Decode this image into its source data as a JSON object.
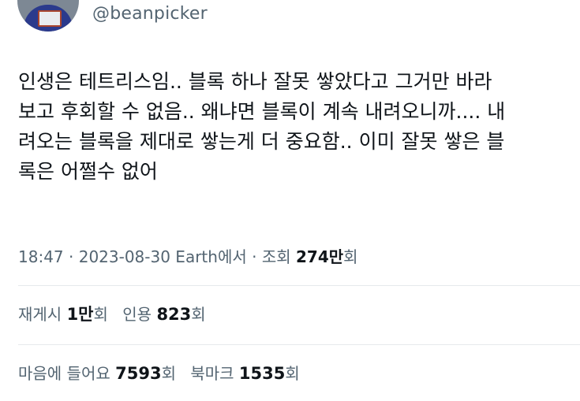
{
  "author": {
    "handle": "@beanpicker"
  },
  "tweet": {
    "text": "인생은 테트리스임.. 블록 하나 잘못 쌓았다고 그거만 바라\n보고 후회할 수 없음.. 왜냐면 블록이 계속 내려오니까.... 내\n려오는 블록을 제대로 쌓는게 더 중요함.. 이미 잘못 쌓은 블\n록은 어쩔수 없어"
  },
  "meta": {
    "time": "18:47",
    "sep1": " · ",
    "date": "2023-08-30",
    "source": " Earth에서",
    "sep2": " · ",
    "views_label": "조회 ",
    "views_value": "274만",
    "views_unit": "회"
  },
  "stats": {
    "retweets": {
      "label": "재게시 ",
      "value": "1만",
      "unit": "회"
    },
    "quotes": {
      "label": "인용 ",
      "value": "823",
      "unit": "회"
    },
    "likes": {
      "label": "마음에 들어요 ",
      "value": "7593",
      "unit": "회"
    },
    "bookmarks": {
      "label": "북마크 ",
      "value": "1535",
      "unit": "회"
    }
  },
  "colors": {
    "text": "#0f1419",
    "secondary": "#536471",
    "divider": "#e6e9ec"
  }
}
